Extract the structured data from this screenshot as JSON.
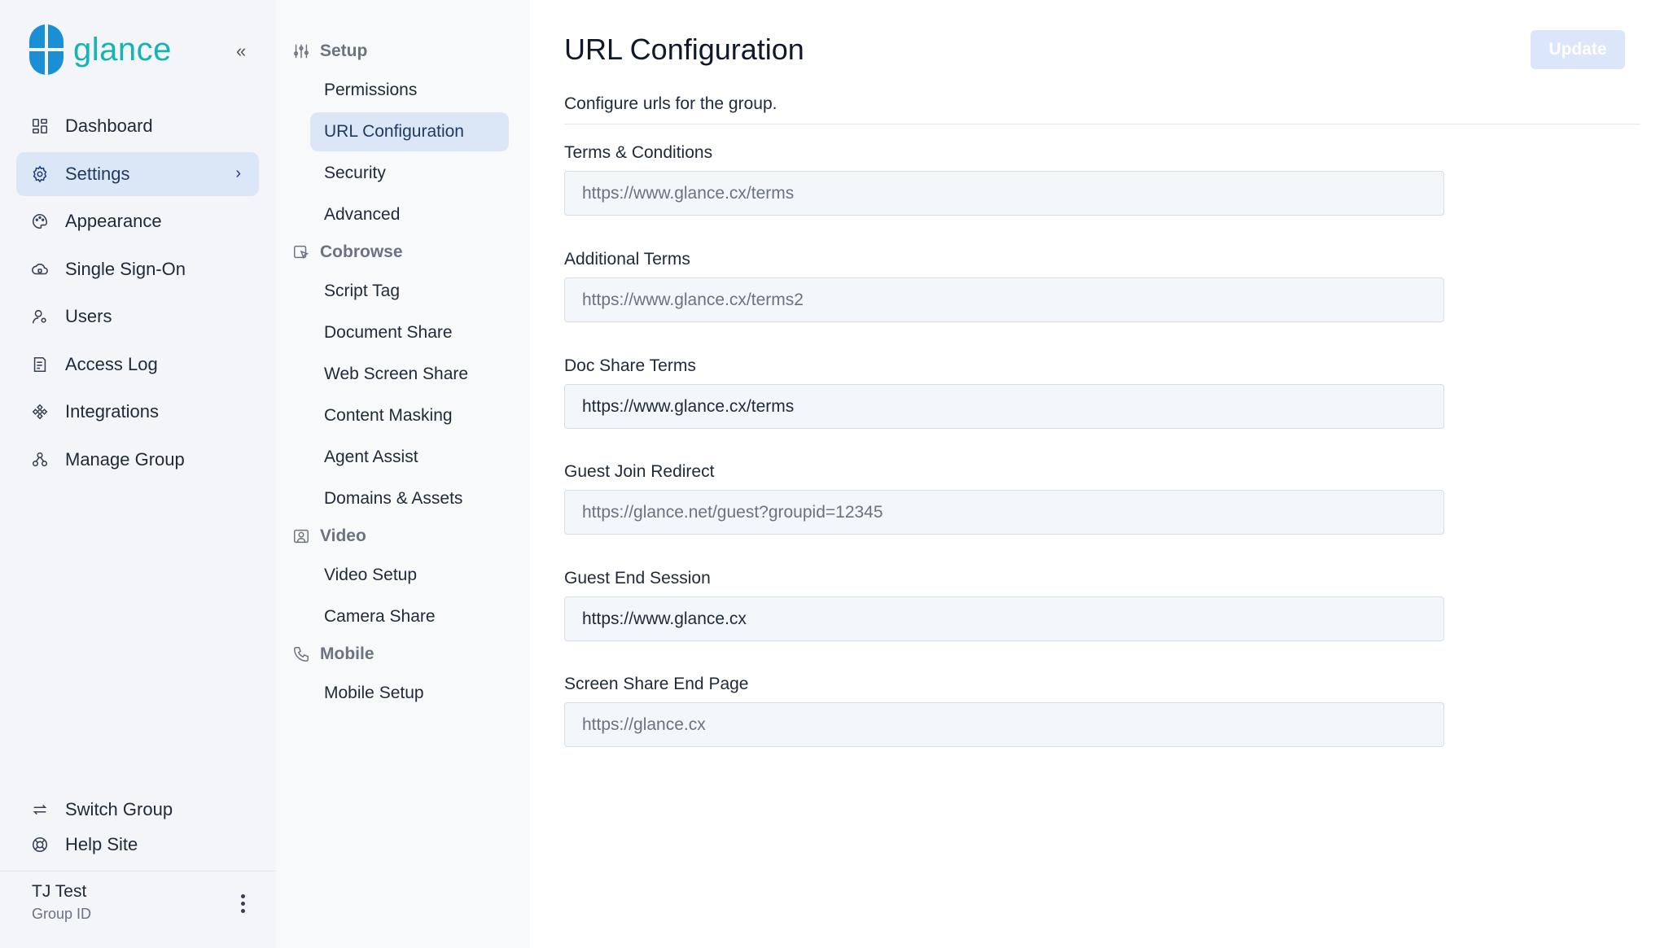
{
  "brand": {
    "name": "glance"
  },
  "sidebar": {
    "collapse_glyph": "«",
    "items": [
      {
        "label": "Dashboard",
        "icon": "dashboard-icon"
      },
      {
        "label": "Settings",
        "icon": "gear-icon",
        "active": true
      },
      {
        "label": "Appearance",
        "icon": "palette-icon"
      },
      {
        "label": "Single Sign-On",
        "icon": "cloud-lock-icon"
      },
      {
        "label": "Users",
        "icon": "user-gear-icon"
      },
      {
        "label": "Access Log",
        "icon": "log-icon"
      },
      {
        "label": "Integrations",
        "icon": "puzzle-icon"
      },
      {
        "label": "Manage Group",
        "icon": "group-icon"
      }
    ],
    "bottom_items": [
      {
        "label": "Switch Group",
        "icon": "switch-icon"
      },
      {
        "label": "Help Site",
        "icon": "lifebuoy-icon"
      }
    ],
    "user": {
      "name": "TJ Test",
      "sub": "Group ID"
    }
  },
  "subnav": {
    "groups": [
      {
        "label": "Setup",
        "icon": "sliders-icon",
        "items": [
          "Permissions",
          "URL Configuration",
          "Security",
          "Advanced"
        ]
      },
      {
        "label": "Cobrowse",
        "icon": "cobrowse-icon",
        "items": [
          "Script Tag",
          "Document Share",
          "Web Screen Share",
          "Content Masking",
          "Agent Assist",
          "Domains & Assets"
        ]
      },
      {
        "label": "Video",
        "icon": "video-icon",
        "items": [
          "Video Setup",
          "Camera Share"
        ]
      },
      {
        "label": "Mobile",
        "icon": "phone-icon",
        "items": [
          "Mobile Setup"
        ]
      }
    ],
    "active_item": "URL Configuration"
  },
  "main": {
    "title": "URL Configuration",
    "update_label": "Update",
    "description": "Configure urls for the group.",
    "fields": [
      {
        "label": "Terms & Conditions",
        "value": "",
        "placeholder": "https://www.glance.cx/terms"
      },
      {
        "label": "Additional Terms",
        "value": "",
        "placeholder": "https://www.glance.cx/terms2"
      },
      {
        "label": "Doc Share Terms",
        "value": "https://www.glance.cx/terms",
        "placeholder": ""
      },
      {
        "label": "Guest Join Redirect",
        "value": "",
        "placeholder": "https://glance.net/guest?groupid=12345"
      },
      {
        "label": "Guest End Session",
        "value": "https://www.glance.cx",
        "placeholder": ""
      },
      {
        "label": "Screen Share End Page",
        "value": "",
        "placeholder": "https://glance.cx"
      }
    ]
  }
}
